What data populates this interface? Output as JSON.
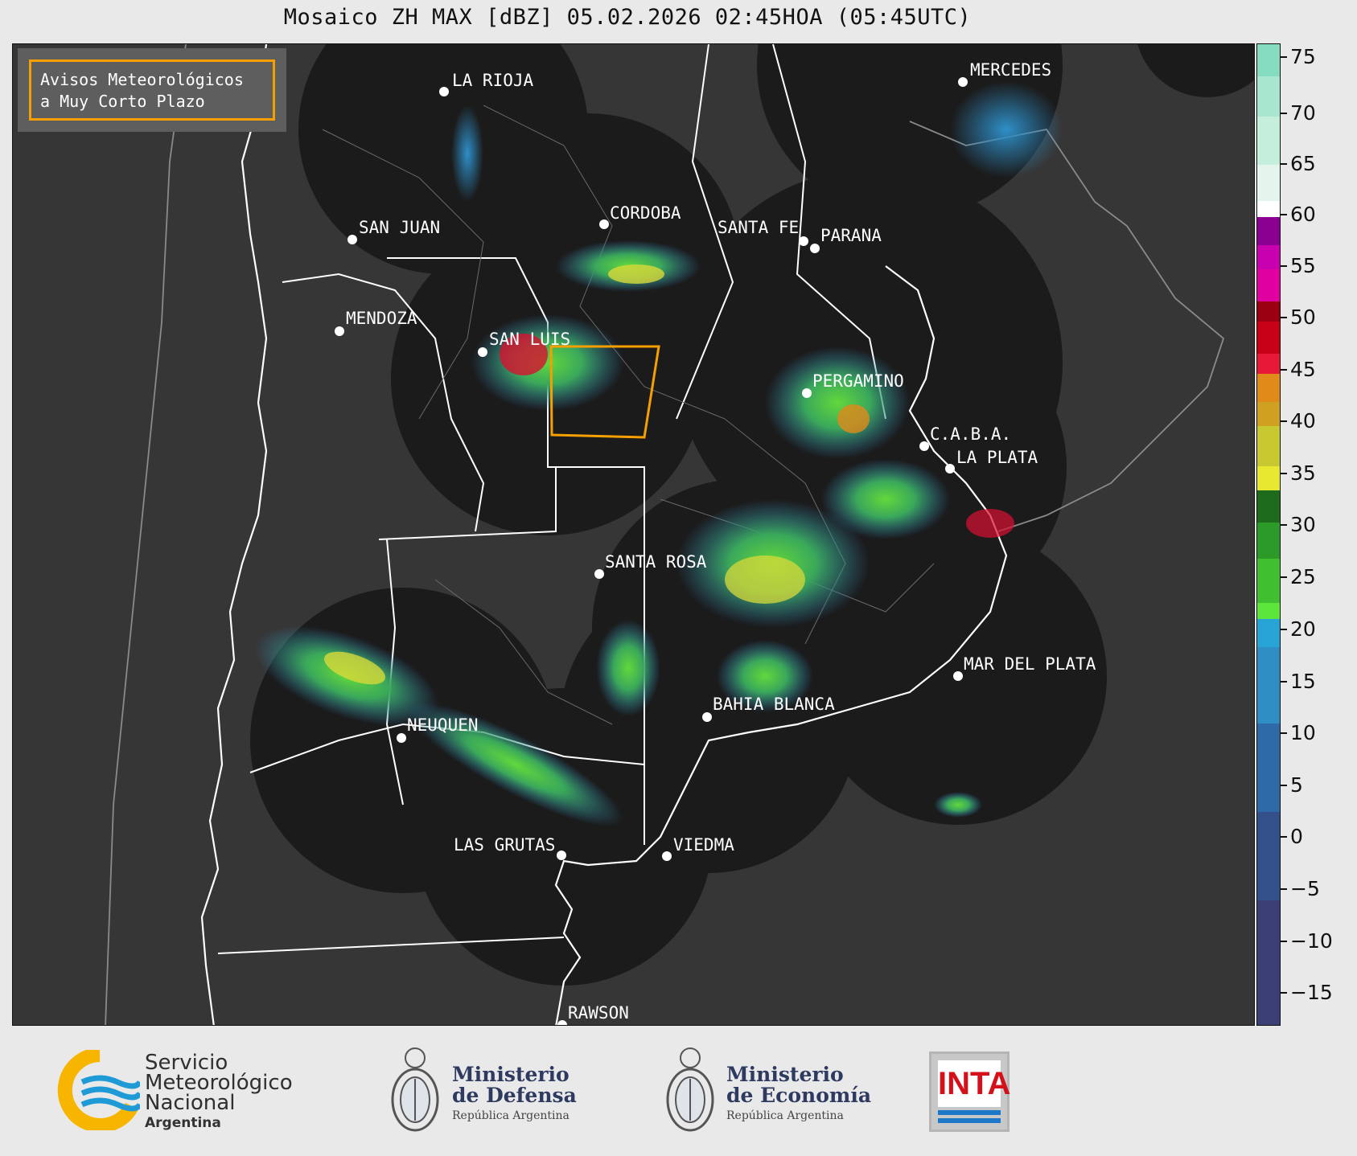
{
  "title": "Mosaico ZH MAX [dBZ] 05.02.2026 02:45HOA (05:45UTC)",
  "alert_box": {
    "line1": "Avisos Meteorológicos",
    "line2": "a Muy Corto Plazo"
  },
  "colorbar": {
    "ticks": [
      "75",
      "70",
      "65",
      "60",
      "55",
      "50",
      "45",
      "40",
      "35",
      "30",
      "25",
      "20",
      "15",
      "10",
      "5",
      "0",
      "−5",
      "−10",
      "−15"
    ],
    "range": [
      -18.5,
      77
    ],
    "colors": {
      "low": "#3b3f75",
      "blue_mid": "#2f6aa8",
      "cyan": "#27a3d6",
      "green_light": "#57e33c",
      "green_dark": "#1e6b1e",
      "yellow": "#e8e830",
      "orange": "#e08a1a",
      "red": "#d81030",
      "dark_red": "#9a0010",
      "magenta": "#e000c0",
      "purple": "#8a0090",
      "white": "#ffffff",
      "aqua": "#7fdcc0"
    }
  },
  "cities": [
    {
      "name": "LA RIOJA"
    },
    {
      "name": "MERCEDES"
    },
    {
      "name": "SAN JUAN"
    },
    {
      "name": "CORDOBA"
    },
    {
      "name": "SANTA FE"
    },
    {
      "name": "PARANA"
    },
    {
      "name": "MENDOZA"
    },
    {
      "name": "SAN LUIS"
    },
    {
      "name": "PERGAMINO"
    },
    {
      "name": "C.A.B.A."
    },
    {
      "name": "LA PLATA"
    },
    {
      "name": "SANTA ROSA"
    },
    {
      "name": "MAR DEL PLATA"
    },
    {
      "name": "BAHIA BLANCA"
    },
    {
      "name": "NEUQUEN"
    },
    {
      "name": "LAS GRUTAS"
    },
    {
      "name": "VIEDMA"
    },
    {
      "name": "RAWSON"
    }
  ],
  "logos": {
    "smn": {
      "line1": "Servicio",
      "line2": "Meteorológico",
      "line3": "Nacional",
      "line4": "Argentina"
    },
    "defensa": {
      "line1": "Ministerio",
      "line2": "de Defensa",
      "line3": "República Argentina"
    },
    "economia": {
      "line1": "Ministerio",
      "line2": "de Economía",
      "line3": "República Argentina"
    },
    "inta": {
      "text": "INTA"
    }
  }
}
